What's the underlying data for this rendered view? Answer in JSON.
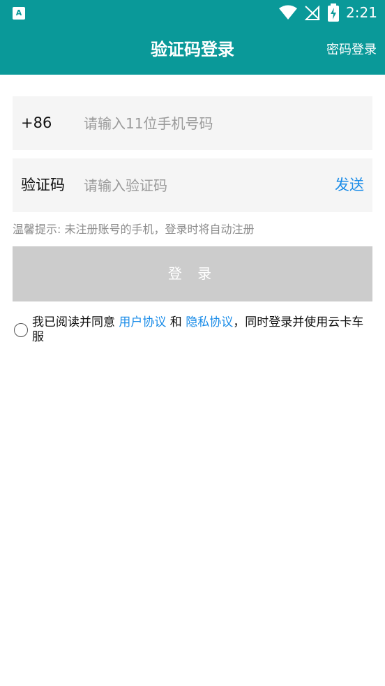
{
  "status_bar": {
    "time": "2:21",
    "icons": [
      "app-notification-icon",
      "wifi-icon",
      "no-signal-icon",
      "battery-charging-icon"
    ]
  },
  "app_bar": {
    "title": "验证码登录",
    "action": "密码登录"
  },
  "phone_field": {
    "prefix": "+86",
    "placeholder": "请输入11位手机号码",
    "value": ""
  },
  "code_field": {
    "label": "验证码",
    "placeholder": "请输入验证码",
    "value": "",
    "send_label": "发送"
  },
  "hint": "温馨提示: 未注册账号的手机，登录时将自动注册",
  "login_button": "登 录",
  "agreement": {
    "checked": false,
    "prefix": "我已阅读并同意 ",
    "user_agreement": "用户协议",
    "and": " 和 ",
    "privacy_agreement": "隐私协议",
    "suffix": "，同时登录并使用云卡车",
    "line2": "服"
  },
  "colors": {
    "primary": "#0a9999",
    "link": "#1a8ce8",
    "button_disabled": "#cccccc",
    "field_bg": "#f5f5f5"
  }
}
